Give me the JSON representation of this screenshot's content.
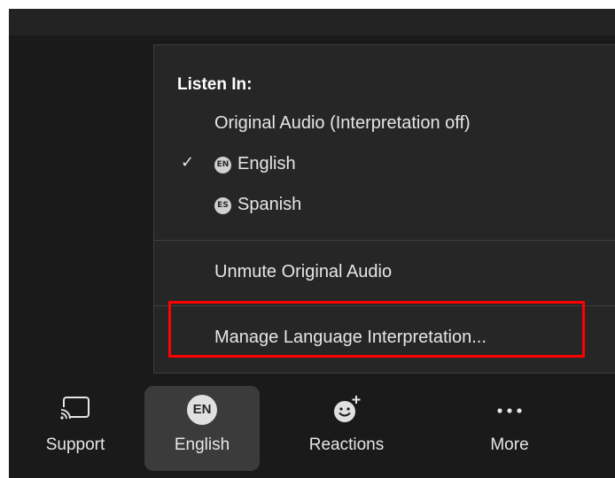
{
  "menu": {
    "header": "Listen In:",
    "items": [
      {
        "label": "Original Audio (Interpretation off)",
        "checked": false,
        "badge": ""
      },
      {
        "label": "English",
        "checked": true,
        "badge": "EN"
      },
      {
        "label": "Spanish",
        "checked": false,
        "badge": "ES"
      }
    ],
    "check_glyph": "✓",
    "unmute": "Unmute Original Audio",
    "manage": "Manage Language Interpretation..."
  },
  "toolbar": {
    "items": [
      {
        "label": "Support",
        "icon": "cast-screen-icon",
        "active": false
      },
      {
        "label": "English",
        "icon": "language-en-icon",
        "icon_text": "EN",
        "active": true
      },
      {
        "label": "Reactions",
        "icon": "add-reaction-icon",
        "active": false
      },
      {
        "label": "More",
        "icon": "more-dots-icon",
        "active": false
      }
    ]
  },
  "colors": {
    "background": "#1a1a1a",
    "menu_background": "#262626",
    "text": "#e6e6e6",
    "highlight": "#ff0000",
    "active_tool": "#3b3b3b"
  }
}
